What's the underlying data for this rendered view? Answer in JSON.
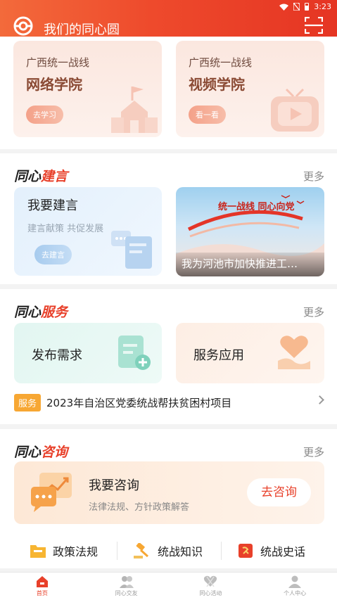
{
  "status_bar": {
    "time": "3:23"
  },
  "header": {
    "title": "我们的同心圆"
  },
  "academies": [
    {
      "prefix": "广西统一战线",
      "name": "网络学院",
      "button": "去学习"
    },
    {
      "prefix": "广西统一战线",
      "name": "视频学院",
      "button": "看一看"
    }
  ],
  "proposal": {
    "heading_black": "同心",
    "heading_red": "建言",
    "more": "更多",
    "card_title": "我要建言",
    "card_subtitle": "建言献策 共促发展",
    "card_button": "去建言",
    "news_caption": "我为河池市加快推进工…",
    "news_image_text": "统一战线 同心向党"
  },
  "service": {
    "heading_black": "同心",
    "heading_red": "服务",
    "more": "更多",
    "tiles": [
      "发布需求",
      "服务应用"
    ],
    "notice_badge": "服务",
    "notice_text": "2023年自治区党委统战帮扶贫困村项目"
  },
  "consult": {
    "heading_black": "同心",
    "heading_red": "咨询",
    "more": "更多",
    "card_title": "我要咨询",
    "card_subtitle": "法律法规、方针政策解答",
    "card_button": "去咨询",
    "links": [
      "政策法规",
      "统战知识",
      "统战史话"
    ]
  },
  "tabbar": [
    {
      "label": "首页",
      "icon": "home-icon",
      "active": true
    },
    {
      "label": "同心交友",
      "icon": "friends-icon",
      "active": false
    },
    {
      "label": "同心活动",
      "icon": "activity-icon",
      "active": false
    },
    {
      "label": "个人中心",
      "icon": "user-icon",
      "active": false
    }
  ],
  "colors": {
    "accent": "#e8402a",
    "header_start": "#f36a3b",
    "header_end": "#e53523",
    "badge": "#f7a733"
  }
}
